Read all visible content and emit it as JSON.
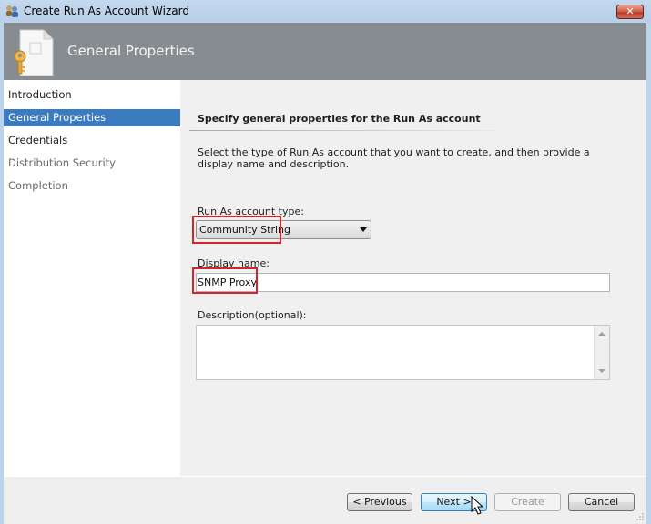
{
  "window": {
    "title": "Create Run As Account Wizard",
    "icon": "users-key-icon",
    "close_label": "✕"
  },
  "header": {
    "title": "General Properties",
    "icon": "document-key-icon"
  },
  "sidebar": {
    "items": [
      {
        "label": "Introduction",
        "state": "normal"
      },
      {
        "label": "General Properties",
        "state": "active"
      },
      {
        "label": "Credentials",
        "state": "normal"
      },
      {
        "label": "Distribution Security",
        "state": "dim"
      },
      {
        "label": "Completion",
        "state": "dim"
      }
    ]
  },
  "main": {
    "section_title": "Specify general properties for the Run As account",
    "intro": "Select the type of Run As account that you want to create, and then provide a display name and description.",
    "account_type": {
      "label": "Run As account type:",
      "value": "Community String"
    },
    "display_name": {
      "label": "Display name:",
      "value": "SNMP Proxy"
    },
    "description": {
      "label": "Description(optional):",
      "value": ""
    }
  },
  "footer": {
    "previous_label": "< Previous",
    "next_label": "Next >",
    "create_label": "Create",
    "cancel_label": "Cancel"
  },
  "colors": {
    "highlight_box": "#d9222a",
    "active_nav": "#3d7bbf",
    "header_band": "#878c90"
  }
}
